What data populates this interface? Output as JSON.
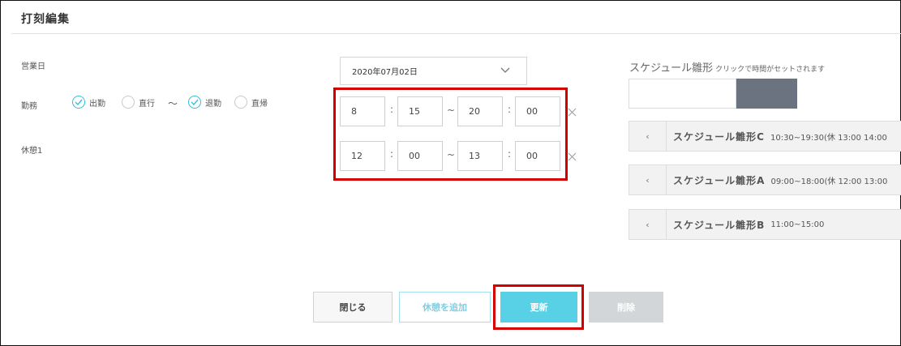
{
  "header": {
    "title": "打刻編集"
  },
  "labels": {
    "business_day": "営業日",
    "attendance": "勤務",
    "break1": "休憩1"
  },
  "attendance": {
    "clock_in": "出勤",
    "direct_go": "直行",
    "tilde": "〜",
    "clock_out": "退勤",
    "direct_return": "直帰"
  },
  "date_select": {
    "value": "2020年07月02日"
  },
  "work_time": {
    "start_h": "8",
    "start_m": "15",
    "end_h": "20",
    "end_m": "00",
    "colon": ":",
    "tilde": "~"
  },
  "break_time": {
    "start_h": "12",
    "start_m": "00",
    "end_h": "13",
    "end_m": "00",
    "colon": ":",
    "tilde": "~"
  },
  "schedule": {
    "title": "スケジュール雛形",
    "hint": "クリックで時間がセットされます",
    "swatch_colors": [
      "#ffffff",
      "#6b7280"
    ],
    "templates": [
      {
        "arrow": "‹",
        "name": "スケジュール雛形C",
        "time": "10:30~19:30(休 13:00 14:00"
      },
      {
        "arrow": "‹",
        "name": "スケジュール雛形A",
        "time": "09:00~18:00(休 12:00 13:00"
      },
      {
        "arrow": "‹",
        "name": "スケジュール雛形B",
        "time": "11:00~15:00"
      }
    ]
  },
  "buttons": {
    "close": "閉じる",
    "add_break": "休憩を追加",
    "update": "更新",
    "delete": "削除"
  },
  "colors": {
    "accent": "#58d0e6",
    "highlight": "#d40000",
    "check": "#35bfe0"
  }
}
